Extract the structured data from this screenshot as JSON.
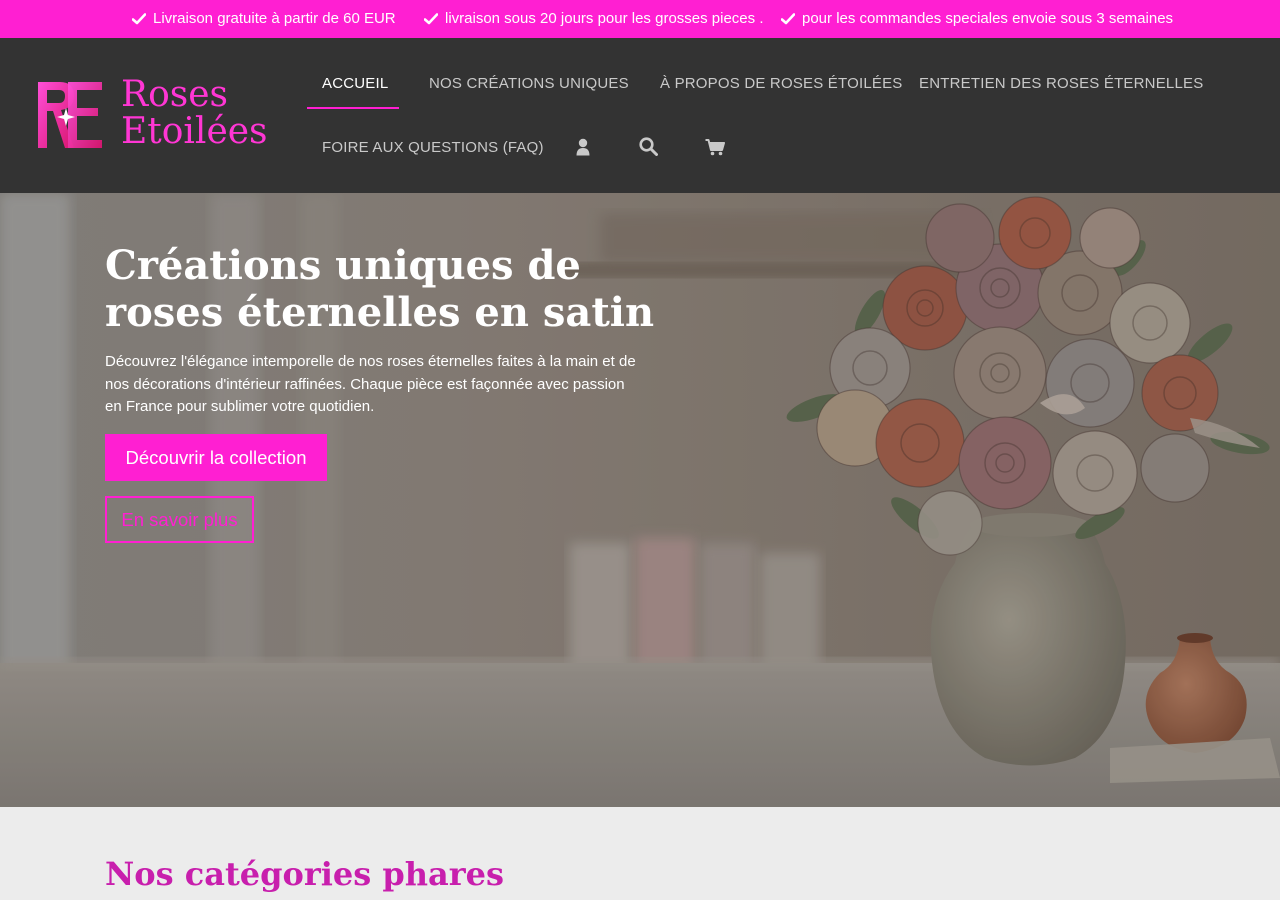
{
  "announcement_bar": {
    "messages": [
      "Livraison gratuite à partir de 60 EUR",
      "livraison sous 20 jours pour les grosses pieces .",
      "pour les commandes speciales envoie sous 3 semaines"
    ],
    "icon": "check-icon",
    "background_color": "#ff1fd2"
  },
  "header": {
    "logo": {
      "monogram": "RE",
      "line1": "Roses",
      "line2": "Etoilées"
    },
    "nav": [
      {
        "label": "ACCUEIL",
        "active": true
      },
      {
        "label": "NOS CRÉATIONS UNIQUES",
        "active": false
      },
      {
        "label": "À PROPOS DE ROSES ÉTOILÉES",
        "active": false
      },
      {
        "label": "ENTRETIEN DES ROSES ÉTERNELLES",
        "active": false
      },
      {
        "label": "FOIRE AUX QUESTIONS (FAQ)",
        "active": false
      }
    ],
    "icons": [
      "user-icon",
      "search-icon",
      "cart-icon"
    ],
    "background_color": "#333333"
  },
  "hero": {
    "title": "Créations uniques de roses éternelles en satin",
    "description": "Découvrez l'élégance intemporelle de nos roses éternelles faites à la main et de nos décorations d'intérieur raffinées. Chaque pièce est façonnée avec passion en France pour sublimer votre quotidien.",
    "primary_button": "Découvrir la collection",
    "secondary_button": "En savoir plus"
  },
  "categories": {
    "title": "Nos catégories phares"
  },
  "colors": {
    "accent": "#ff1fd2",
    "section_title": "#c81fad"
  }
}
